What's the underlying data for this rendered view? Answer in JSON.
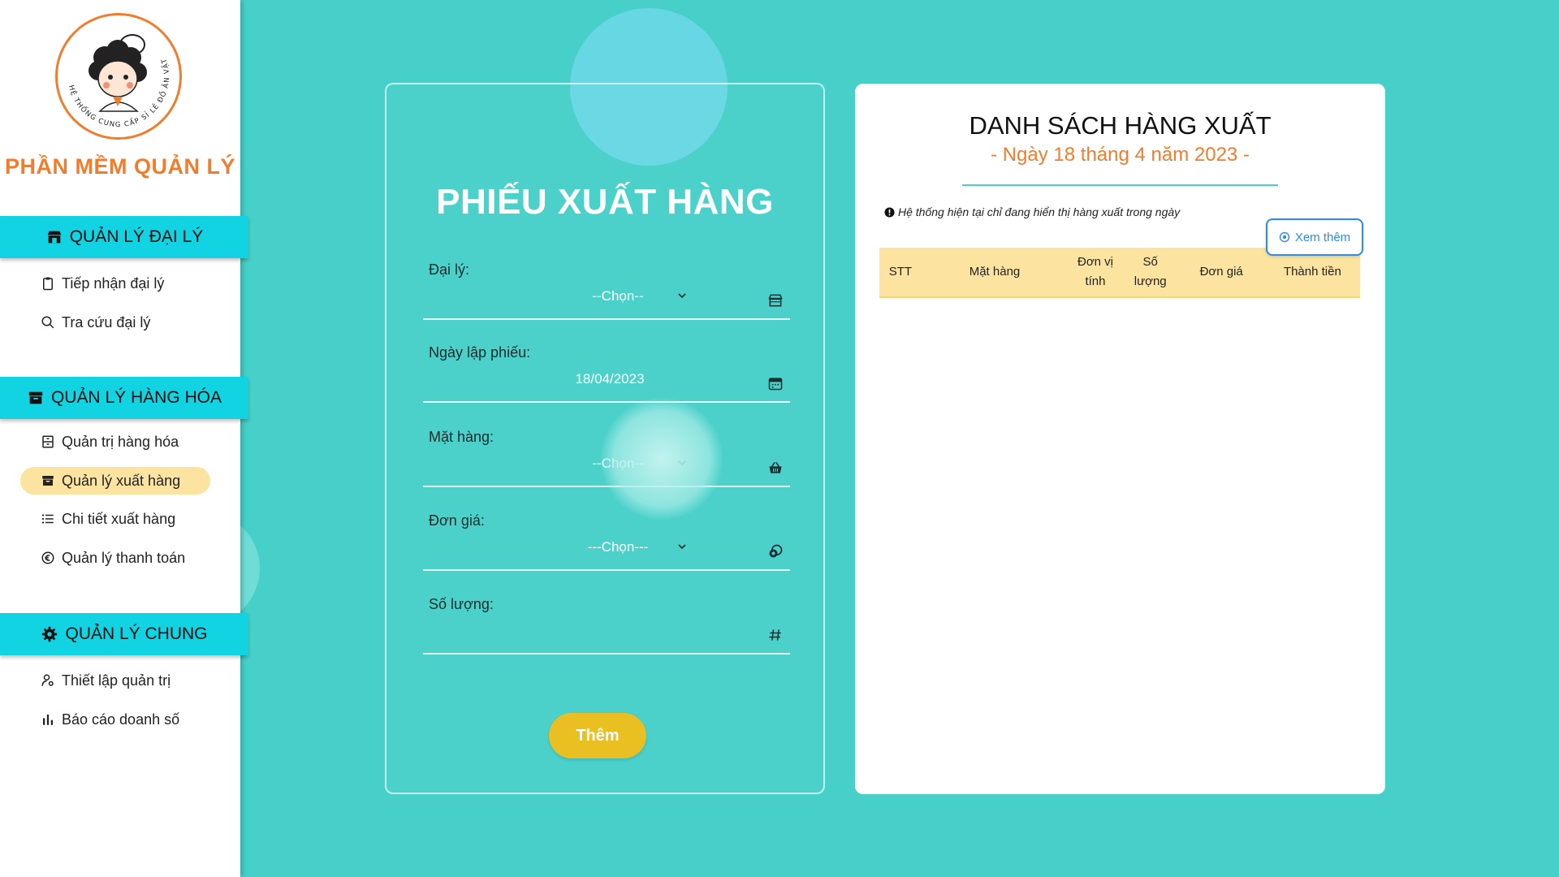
{
  "brand": {
    "logo_ring_text": "HỆ THỐNG CUNG CẤP SỈ LẺ ĐỒ ĂN VẶT",
    "name": "PHẦN MỀM QUẢN LÝ"
  },
  "sidebar": {
    "sections": [
      {
        "label": "QUẢN LÝ ĐẠI LÝ",
        "icon": "store-icon",
        "items": [
          {
            "label": "Tiếp nhận đại lý",
            "icon": "clipboard-icon"
          },
          {
            "label": "Tra cứu đại lý",
            "icon": "search-icon"
          }
        ]
      },
      {
        "label": "QUẢN LÝ HÀNG HÓA",
        "icon": "archive-icon",
        "items": [
          {
            "label": "Quản trị hàng hóa",
            "icon": "inventory-icon"
          },
          {
            "label": "Quản lý xuất hàng",
            "icon": "box-icon",
            "active": true
          },
          {
            "label": "Chi tiết xuất hàng",
            "icon": "list-icon"
          },
          {
            "label": "Quản lý thanh toán",
            "icon": "euro-icon"
          }
        ]
      },
      {
        "label": "QUẢN LÝ CHUNG",
        "icon": "gear-icon",
        "items": [
          {
            "label": "Thiết lập quản trị",
            "icon": "user-gear-icon"
          },
          {
            "label": "Báo cáo doanh số",
            "icon": "bar-chart-icon"
          }
        ]
      }
    ]
  },
  "form": {
    "title": "PHIẾU XUẤT HÀNG",
    "fields": [
      {
        "label": "Đại lý:",
        "value": "--Chọn--",
        "icon": "store-icon"
      },
      {
        "label": "Ngày lập phiếu:",
        "value": "18/04/2023",
        "icon": "calendar-icon"
      },
      {
        "label": "Mặt hàng:",
        "value": "--Chọn--",
        "icon": "basket-icon"
      },
      {
        "label": "Đơn giá:",
        "value": "---Chọn---",
        "icon": "coins-icon"
      },
      {
        "label": "Số lượng:",
        "value": "",
        "icon": "hash-icon"
      }
    ],
    "submit_label": "Thêm"
  },
  "list": {
    "title": "DANH SÁCH HÀNG XUẤT",
    "date_line": "- Ngày 18 tháng 4 năm 2023 -",
    "notice": "Hệ thống hiện tại chỉ đang hiển thị hàng xuất trong ngày",
    "more_label": "Xem thêm",
    "columns": [
      "STT",
      "Mặt hàng",
      "Đơn vị tính",
      "Số lượng",
      "Đơn giá",
      "Thành tiền"
    ],
    "rows": []
  },
  "colors": {
    "background": "#47d0c9",
    "accent_orange": "#f07d2e",
    "section_cyan": "#12d3e2",
    "button_yellow": "#eabf22",
    "table_header": "#fde3a0",
    "link_blue": "#2a8de8"
  }
}
